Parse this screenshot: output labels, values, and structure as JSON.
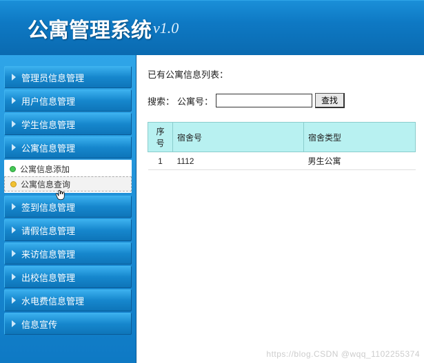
{
  "header": {
    "title": "公寓管理系统",
    "version": "v1.0"
  },
  "sidebar": {
    "items": [
      {
        "label": "管理员信息管理"
      },
      {
        "label": "用户信息管理"
      },
      {
        "label": "学生信息管理"
      },
      {
        "label": "公寓信息管理"
      },
      {
        "label": "签到信息管理"
      },
      {
        "label": "请假信息管理"
      },
      {
        "label": "来访信息管理"
      },
      {
        "label": "出校信息管理"
      },
      {
        "label": "水电费信息管理"
      },
      {
        "label": "信息宣传"
      }
    ],
    "submenu": {
      "add_label": "公寓信息添加",
      "query_label": "公寓信息查询"
    }
  },
  "main": {
    "list_title": "已有公寓信息列表：",
    "search_label": "搜索：",
    "search_field_label": "公寓号：",
    "search_placeholder": "",
    "search_value": "",
    "search_button": "查找",
    "table": {
      "headers": [
        "序号",
        "宿舍号",
        "宿舍类型"
      ],
      "rows": [
        {
          "idx": "1",
          "dorm_no": "1112",
          "dorm_type": "男生公寓"
        }
      ]
    }
  },
  "watermark": "https://blog.CSDN @wqq_1102255374"
}
